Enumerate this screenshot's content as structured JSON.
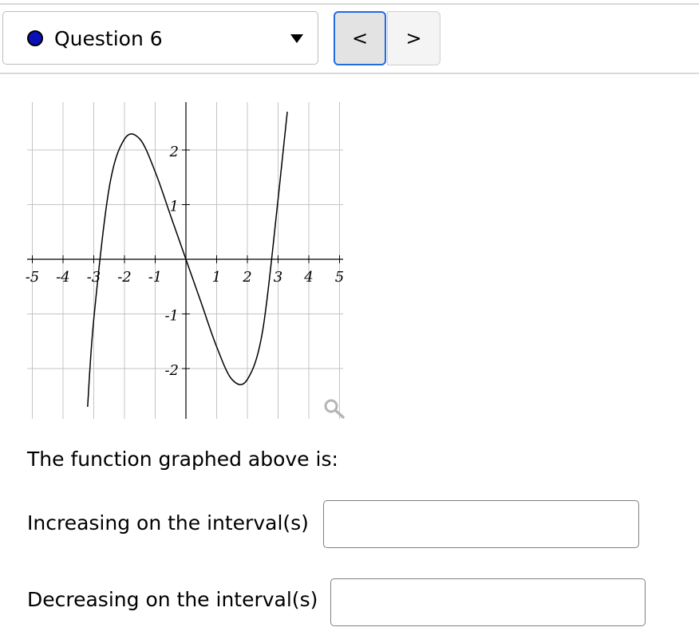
{
  "header": {
    "question_label": "Question 6",
    "status_dot_color": "#0a11b8",
    "dropdown_icon": "caret-down-icon",
    "prev_label": "<",
    "next_label": ">"
  },
  "chart_data": {
    "type": "line",
    "title": "",
    "xlabel": "",
    "ylabel": "",
    "xlim": [
      -5,
      5
    ],
    "ylim": [
      -2.7,
      2.7
    ],
    "grid": true,
    "x_ticks": [
      "-5",
      "-4",
      "-3",
      "-2",
      "-1",
      "1",
      "2",
      "3",
      "4",
      "5"
    ],
    "y_ticks": [
      "2",
      "1",
      "-1",
      "-2"
    ],
    "series": [
      {
        "x": [
          -3.2,
          -3.0,
          -2.5,
          -2.0,
          -1.5,
          -1.0,
          -0.5,
          0.0,
          0.5,
          1.0,
          1.5,
          2.0,
          2.5,
          3.0,
          3.3
        ],
        "y": [
          -2.7,
          -1.1,
          1.3,
          2.2,
          2.2,
          1.6,
          0.8,
          0.0,
          -0.8,
          -1.6,
          -2.2,
          -2.2,
          -1.3,
          1.1,
          2.7
        ]
      }
    ],
    "zoom_icon": "magnifier-icon"
  },
  "content": {
    "prompt": "The function graphed above is:",
    "increasing_label": "Increasing on the interval(s)",
    "increasing_value": "",
    "decreasing_label": "Decreasing on the interval(s)",
    "decreasing_value": ""
  }
}
